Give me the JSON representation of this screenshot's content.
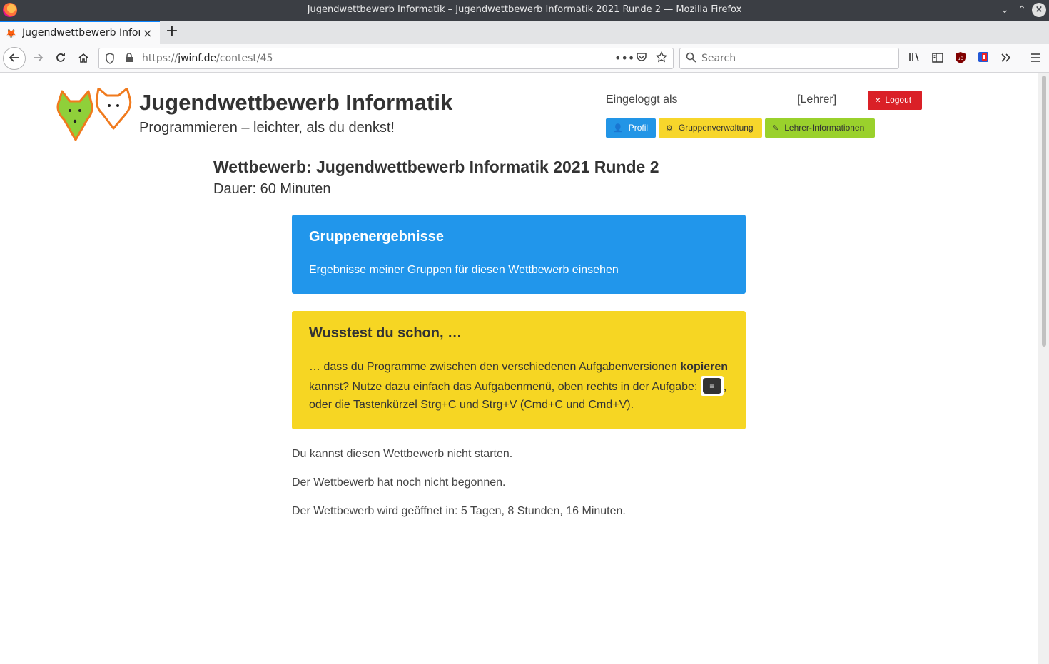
{
  "window": {
    "title": "Jugendwettbewerb Informatik – Jugendwettbewerb Informatik 2021 Runde 2 — Mozilla Firefox",
    "minimize_glyph": "⌄",
    "maximize_glyph": "⌃",
    "close_glyph": "×"
  },
  "tab": {
    "title": "Jugendwettbewerb Informatik",
    "close_glyph": "×",
    "new_tab_glyph": "+"
  },
  "navbar": {
    "url_prefix": "https://",
    "url_host": "jwinf.de",
    "url_path": "/contest/45",
    "search_placeholder": "Search",
    "page_actions_glyph": "•••"
  },
  "header": {
    "site_title": "Jugendwettbewerb Informatik",
    "site_subtitle": "Programmieren – leichter, als du denkst!",
    "logged_in_label": "Eingeloggt als",
    "role_label": "[Lehrer]",
    "logout_label": "Logout",
    "buttons": {
      "profil": "Profil",
      "gruppenverwaltung": "Gruppenverwaltung",
      "lehrer_informationen": "Lehrer-Informationen"
    }
  },
  "contest": {
    "title": "Wettbewerb: Jugendwettbewerb Informatik 2021 Runde 2",
    "duration": "Dauer: 60 Minuten"
  },
  "group_results_card": {
    "heading": "Gruppenergebnisse",
    "link": "Ergebnisse meiner Gruppen für diesen Wettbewerb einsehen"
  },
  "did_you_know_card": {
    "heading": "Wusstest du schon, …",
    "text_part1": "… dass du Programme zwischen den verschiedenen Aufgabenversionen ",
    "text_bold": "kopieren",
    "text_part2": " kannst? Nutze dazu einfach das Aufgabenmenü, oben rechts in der Aufgabe: ",
    "menu_glyph": "≡",
    "text_part3": ", oder die Tastenkürzel Strg+C und Strg+V (Cmd+C und Cmd+V)."
  },
  "messages": {
    "cannot_start": "Du kannst diesen Wettbewerb nicht starten.",
    "not_started": "Der Wettbewerb hat noch nicht begonnen.",
    "opens_in": "Der Wettbewerb wird geöffnet in: 5 Tagen, 8 Stunden, 16 Minuten."
  }
}
